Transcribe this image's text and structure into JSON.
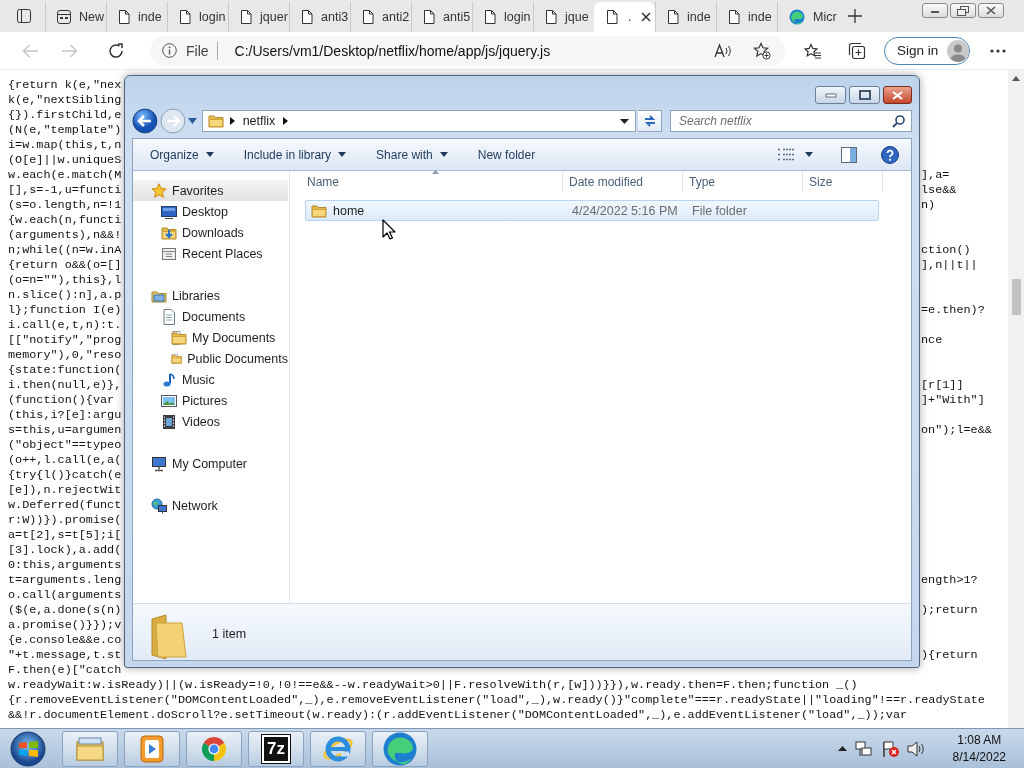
{
  "browser": {
    "tabs": [
      {
        "label": "New",
        "kind": "newtab",
        "selected": false
      },
      {
        "label": "inde",
        "kind": "page",
        "selected": false
      },
      {
        "label": "login",
        "kind": "page",
        "selected": false
      },
      {
        "label": "jquer",
        "kind": "page",
        "selected": false
      },
      {
        "label": "anti3",
        "kind": "page",
        "selected": false
      },
      {
        "label": "anti2",
        "kind": "page",
        "selected": false
      },
      {
        "label": "anti5",
        "kind": "page",
        "selected": false
      },
      {
        "label": "login",
        "kind": "page",
        "selected": false
      },
      {
        "label": "jque",
        "kind": "page",
        "selected": false
      },
      {
        "label": ".",
        "kind": "page",
        "selected": true
      },
      {
        "label": "inde",
        "kind": "page",
        "selected": false
      },
      {
        "label": "inde",
        "kind": "page",
        "selected": false
      },
      {
        "label": "Micr",
        "kind": "edge",
        "selected": false
      }
    ],
    "back": {
      "disabled": true
    },
    "forward": {
      "disabled": true
    },
    "address": {
      "scheme": "File",
      "url": "C:/Users/vm1/Desktop/netflix/home/app/js/jquery.js"
    },
    "sign_in": "Sign in"
  },
  "code": {
    "rows": [
      {
        "kind": "split",
        "left": "{return k(e,\"nex"
      },
      {
        "kind": "split",
        "left": "k(e,\"nextSibling"
      },
      {
        "kind": "split",
        "left": "{}).firstChild,e"
      },
      {
        "kind": "split",
        "left": "(N(e,\"template\")"
      },
      {
        "kind": "split",
        "left": "i=w.map(this,t,n"
      },
      {
        "kind": "split",
        "left": "(O[e]||w.uniqueS"
      },
      {
        "kind": "split",
        "left": "w.each(e.match(M",
        "right": "],a="
      },
      {
        "kind": "split",
        "left": "[],s=-1,u=functi",
        "right": "lse&&"
      },
      {
        "kind": "split",
        "left": "(s=o.length,n=!1",
        "right": "n)"
      },
      {
        "kind": "split",
        "left": "{w.each(n,functi"
      },
      {
        "kind": "split",
        "left": "(arguments),n&&!"
      },
      {
        "kind": "split",
        "left": "n;while((n=w.inA",
        "right": "ction()"
      },
      {
        "kind": "split",
        "left": "{return o&&(o=[]",
        "right": "],n||t||"
      },
      {
        "kind": "split",
        "left": "(o=n=\"\"),this},l"
      },
      {
        "kind": "split",
        "left": "n.slice():n],a.p"
      },
      {
        "kind": "split",
        "left": "l};function I(e)",
        "right": "=e.then)?"
      },
      {
        "kind": "split",
        "left": "i.call(e,t,n):t."
      },
      {
        "kind": "split",
        "left": "[[\"notify\",\"prog",
        "right": "nce"
      },
      {
        "kind": "split",
        "left": "memory\"),0,\"reso"
      },
      {
        "kind": "split",
        "left": "{state:function("
      },
      {
        "kind": "split",
        "left": "i.then(null,e)},",
        "right": "[r[1]]"
      },
      {
        "kind": "split",
        "left": "(function(){var",
        "right": "]+\"With\"]"
      },
      {
        "kind": "split",
        "left": "(this,i?[e]:argu"
      },
      {
        "kind": "split",
        "left": "s=this,u=argumen",
        "right": "on\");l=e&&"
      },
      {
        "kind": "split",
        "left": "(\"object\"==typeo"
      },
      {
        "kind": "split",
        "left": "(o++,l.call(e,a("
      },
      {
        "kind": "split",
        "left": "{try{l()}catch(e"
      },
      {
        "kind": "split",
        "left": "[e]),n.rejectWit"
      },
      {
        "kind": "split",
        "left": "w.Deferred(funct"
      },
      {
        "kind": "split",
        "left": "r:W))}).promise("
      },
      {
        "kind": "split",
        "left": "a=t[2],s=t[5];i["
      },
      {
        "kind": "split",
        "left": "[3].lock),a.add("
      },
      {
        "kind": "split",
        "left": "0:this,arguments"
      },
      {
        "kind": "split",
        "left": "t=arguments.leng",
        "right": "ength>1?"
      },
      {
        "kind": "split",
        "left": "o.call(arguments"
      },
      {
        "kind": "split",
        "left": "($(e,a.done(s(n)",
        "right": ");return"
      },
      {
        "kind": "split",
        "left": "a.promise()}});v"
      },
      {
        "kind": "split",
        "left": "{e.console&&e.co"
      },
      {
        "kind": "split",
        "left": "\"+t.message,t.st",
        "right": "){return"
      },
      {
        "kind": "split",
        "left": "F.then(e)[\"catch"
      },
      {
        "kind": "full",
        "text": "w.readyWait:w.isReady)||(w.isReady=!0,!0!==e&&--w.readyWait>0||F.resolveWith(r,[w]))}}),w.ready.then=F.then;function _()"
      },
      {
        "kind": "full",
        "text": "{r.removeEventListener(\"DOMContentLoaded\",_),e.removeEventListener(\"load\",_),w.ready()}\"complete\"===r.readyState||\"loading\"!==r.readyState"
      },
      {
        "kind": "full",
        "text": "&&!r.documentElement.doScroll?e.setTimeout(w.ready):(r.addEventListener(\"DOMContentLoaded\",_),e.addEventListener(\"load\",_));var"
      }
    ]
  },
  "explorer": {
    "path": [
      {
        "label": "netflix"
      }
    ],
    "search": {
      "placeholder": "Search netflix"
    },
    "toolbar": [
      {
        "label": "Organize",
        "dropdown": true
      },
      {
        "label": "Include in library",
        "dropdown": true
      },
      {
        "label": "Share with",
        "dropdown": true
      },
      {
        "label": "New folder",
        "dropdown": false
      }
    ],
    "nav_pane": [
      {
        "label": "Favorites",
        "kind": "star",
        "selected": true,
        "children": [
          {
            "label": "Desktop",
            "kind": "desktop",
            "selected": false
          },
          {
            "label": "Downloads",
            "kind": "downloads",
            "selected": false
          },
          {
            "label": "Recent Places",
            "kind": "recent",
            "selected": false
          }
        ]
      },
      {
        "label": "Libraries",
        "kind": "library",
        "selected": false,
        "children": [
          {
            "label": "Documents",
            "kind": "documents",
            "selected": false,
            "children": [
              {
                "label": "My Documents",
                "kind": "folder",
                "selected": false
              },
              {
                "label": "Public Documents",
                "kind": "folder",
                "selected": false
              }
            ]
          },
          {
            "label": "Music",
            "kind": "music",
            "selected": false
          },
          {
            "label": "Pictures",
            "kind": "pictures",
            "selected": false
          },
          {
            "label": "Videos",
            "kind": "videos",
            "selected": false
          }
        ]
      },
      {
        "label": "My Computer",
        "kind": "computer",
        "selected": false
      },
      {
        "label": "Network",
        "kind": "network",
        "selected": false
      }
    ],
    "columns": [
      {
        "label": "Name",
        "sorted": true
      },
      {
        "label": "Date modified",
        "sorted": false
      },
      {
        "label": "Type",
        "sorted": false
      },
      {
        "label": "Size",
        "sorted": false
      }
    ],
    "files": [
      {
        "name": "home",
        "date_modified": "4/24/2022 5:16 PM",
        "type": "File folder",
        "selected": true
      }
    ],
    "status": "1 item"
  },
  "taskbar": {
    "apps": [
      {
        "kind": "explorer"
      },
      {
        "kind": "media-player"
      },
      {
        "kind": "chrome"
      },
      {
        "kind": "archiver",
        "label": "7z"
      },
      {
        "kind": "ie"
      },
      {
        "kind": "edge"
      }
    ],
    "clock": {
      "time": "1:08 AM",
      "date": "8/14/2022"
    }
  }
}
